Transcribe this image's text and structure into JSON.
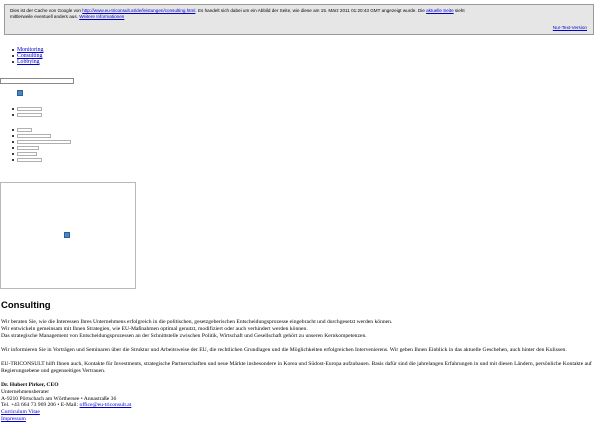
{
  "banner": {
    "line1_prefix": "Dies ist der Cache von Google von ",
    "url": "http://www.eu-triconsult.at/de/leistungen/consulting.html",
    "line1_mid": ". Es handelt sich dabei um ein Abbild der Seite, wie diese am 15. März 2011 01:20:43 GMT angezeigt wurde. Die ",
    "current_link": "aktuelle Seite",
    "line1_suffix": " sieht",
    "line2_prefix": "mittlerweile eventuell anders aus. ",
    "more_info_link": "Weitere Informationen",
    "text_only_link": "Nur-Text-Version"
  },
  "nav": [
    {
      "label": "Monitoring"
    },
    {
      "label": "Consulting"
    },
    {
      "label": "Lobbying"
    }
  ],
  "content": {
    "title": "Consulting",
    "para1_line1": "Wir beraten Sie, wie die Interessen Ihres Unternehmens erfolgreich in die politischen, gesetzgeberischen Entscheidungsprozesse eingebracht und durchgesetzt werden können.",
    "para1_line2": "Wir entwickeln gemeinsam mit Ihnen Strategien, wie EU-Maßnahmen optimal genutzt, modifiziert oder auch verhindert werden können.",
    "para1_line3": "Das strategische Management von Entscheidungsprozessen an der Schnittstelle zwischen Politik, Wirtschaft und Gesellschaft gehört zu unseren Kernkompetenzen.",
    "para2": "Wir informieren Sie in Vorträgen und Seminaren über die Struktur und Arbeitsweise der EU, die rechtlichen Grundlagen und die Möglichkeiten erfolgreichen Intervenierens. Wir geben Ihnen Einblick in das aktuelle Geschehen, auch hinter den Kulissen.",
    "para3": "EU-TRICONSULT hilft Ihnen auch, Kontakte für Investments, strategische Partnerschaften und neue Märkte insbesondere in Korea und Südost-Europa aufzubauen. Basis dafür sind die jahrelangen Erfahrungen in und mit diesen Ländern, persönliche Kontakte auf Regierungsebene und gegenseitiges Vertrauen."
  },
  "contact": {
    "name": "Dr. Hubert Pirker, CEO",
    "role": "Unternehmensberater",
    "address": "A-9210 Pörtschach am Wörthersee • Annastraße 36",
    "phone_prefix": "Tel. +43 664 73 969 206 • E-Mail: ",
    "email": "office@eu-triconsult.at",
    "cv_link": "Curriculum Vitae",
    "imprint_link": "Impressum"
  }
}
